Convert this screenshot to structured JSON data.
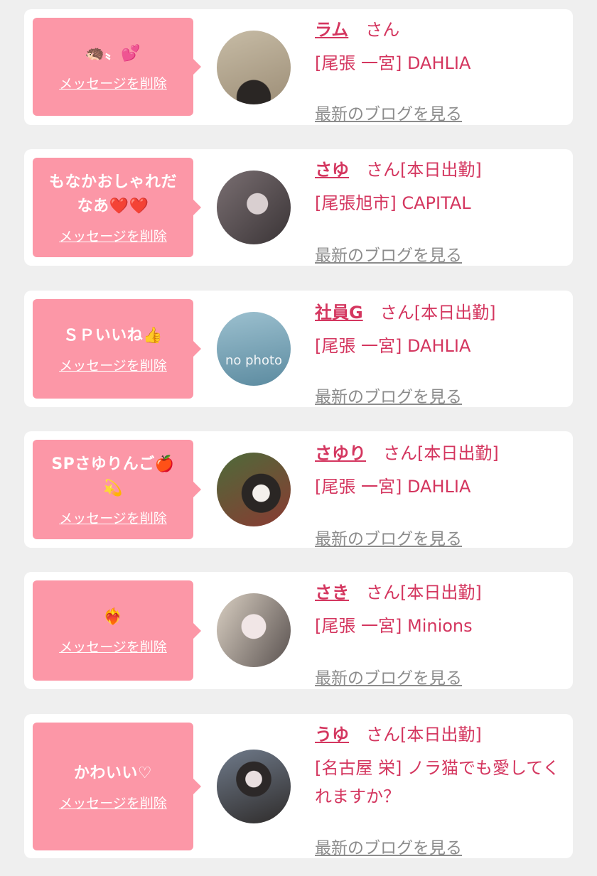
{
  "delete_label": "メッセージを削除",
  "honorific": "さん",
  "blog_label": "最新のブログを見る",
  "colors": {
    "bubble": "#fc97a7",
    "accent": "#d4365f",
    "link_gray": "#8c8c8c",
    "card": "#ffffff",
    "page_bg": "#efefef"
  },
  "cards": [
    {
      "message": "🦔〟💕",
      "name": "ラム",
      "status": "",
      "shop": "[尾張 一宮] DAHLIA"
    },
    {
      "message": "もなかおしゃれだなあ❤️❤️",
      "name": "さゆ",
      "status": "[本日出勤]",
      "shop": "[尾張旭市] CAPITAL"
    },
    {
      "message": "ＳＰいいね👍",
      "name": "社員G",
      "status": "[本日出勤]",
      "shop": "[尾張 一宮] DAHLIA",
      "avatar_text": "no photo"
    },
    {
      "message": "SPさゆりんご🍎💫",
      "name": "さゆり",
      "status": "[本日出勤]",
      "shop": "[尾張 一宮] DAHLIA"
    },
    {
      "message": "❤️‍🔥",
      "name": "さき",
      "status": "[本日出勤]",
      "shop": "[尾張 一宮] Minions"
    },
    {
      "message": "かわいい♡",
      "name": "うゆ",
      "status": "[本日出勤]",
      "shop": "[名古屋 栄] ノラ猫でも愛してくれますか？"
    }
  ]
}
